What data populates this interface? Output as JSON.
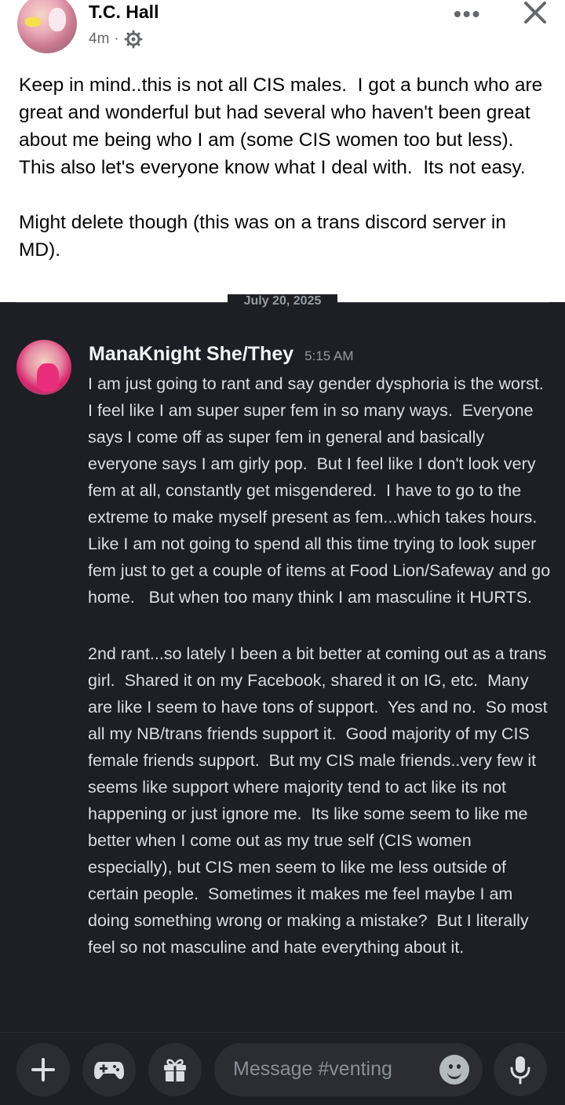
{
  "facebook_post": {
    "author": "T.C. Hall",
    "time": "4m",
    "separator": "·",
    "more_label": "•••",
    "body": "Keep in mind..this is not all CIS males.  I got a bunch who are great and wonderful but had several who haven't been great about me being who I am (some CIS women too but less).  This also let's everyone know what I deal with.  Its not easy.\n\nMight delete though (this was on a trans discord server in MD)."
  },
  "discord": {
    "date_divider": "July 20, 2025",
    "message": {
      "username": "ManaKnight She/They",
      "timestamp": "5:15 AM",
      "paragraphs": [
        "I am just going to rant and say gender dysphoria is the worst.  I feel like I am super super fem in so many ways.  Everyone says I come off as super fem in general and basically everyone says I am girly pop.  But I feel like I don't look very fem at all, constantly get misgendered.  I have to go to the extreme to make myself present as fem...which takes hours.  Like I am not going to spend all this time trying to look super fem just to get a couple of items at Food Lion/Safeway and go home.   But when too many think I am masculine it HURTS.",
        "2nd rant...so lately I been a bit better at coming out as a trans girl.  Shared it on my Facebook, shared it on IG, etc.  Many are like I seem to have tons of support.  Yes and no.  So most all my NB/trans friends support it.  Good majority of my CIS female friends support.  But my CIS male friends..very few it seems like support where majority tend to act like its not happening or just ignore me.  Its like some seem to like me better when I come out as my true self (CIS women especially), but CIS men seem to like me less outside of certain people.  Sometimes it makes me feel maybe I am doing something wrong or making a mistake?  But I literally feel so not masculine and hate everything about it."
      ]
    },
    "input": {
      "placeholder": "Message #venting"
    },
    "icons": [
      "plus-icon",
      "gamepad-icon",
      "gift-icon",
      "emoji-icon",
      "microphone-icon"
    ]
  },
  "colors": {
    "discord_bg": "#1e1f24",
    "discord_text": "#dbdee1",
    "discord_username": "#f2f3f5",
    "discord_muted": "#949ba4",
    "fb_text": "#050505",
    "fb_muted": "#65676b"
  }
}
